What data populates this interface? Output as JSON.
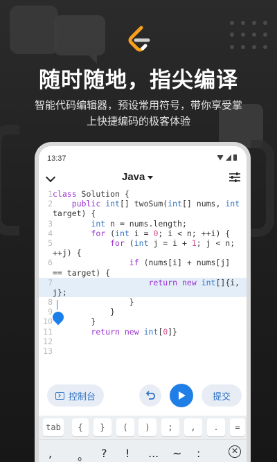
{
  "promo": {
    "headline": "随时随地，指尖编译",
    "subline1": "智能代码编辑器，预设常用符号，带你享受掌",
    "subline2": "上快捷编码的极客体验",
    "accent_color": "#f89f1b",
    "logo_icon": "leetcode-logo-icon"
  },
  "status_bar": {
    "time": "13:37",
    "icons": [
      "wifi-icon",
      "signal-icon",
      "battery-icon"
    ]
  },
  "toolbar": {
    "collapse_icon": "chevron-down-icon",
    "language": "Java",
    "settings_icon": "tune-icon"
  },
  "editor": {
    "lines": [
      {
        "n": "1",
        "text": "class Solution {"
      },
      {
        "n": "2",
        "text": "    public int[] twoSum(int[] nums, int"
      },
      {
        "n": "",
        "text": "target) {"
      },
      {
        "n": "3",
        "text": "        int n = nums.length;"
      },
      {
        "n": "4",
        "text": "        for (int i = 0; i < n; ++i) {"
      },
      {
        "n": "5",
        "text": "            for (int j = i + 1; j < n;"
      },
      {
        "n": "",
        "text": "++j) {"
      },
      {
        "n": "6",
        "text": "                if (nums[i] + nums[j]"
      },
      {
        "n": "",
        "text": "== target) {"
      },
      {
        "n": "7",
        "text": "                    return new int[]{i,"
      },
      {
        "n": "",
        "text": "j};"
      },
      {
        "n": "8",
        "text": "                }"
      },
      {
        "n": "9",
        "text": "            }"
      },
      {
        "n": "10",
        "text": "        }"
      },
      {
        "n": "11",
        "text": "        return new int[0]}"
      },
      {
        "n": "12",
        "text": ""
      },
      {
        "n": "13",
        "text": ""
      }
    ],
    "highlight_color": "#e3eef9"
  },
  "actions": {
    "console_label": "控制台",
    "submit_label": "提交",
    "undo_icon": "undo-icon",
    "run_icon": "play-icon"
  },
  "symbol_keys": [
    "tab",
    "{",
    "}",
    "(",
    ")",
    ";",
    ",",
    ".",
    "="
  ],
  "ime_keys": [
    ",",
    "。",
    "?",
    "!",
    "...",
    "~",
    ":"
  ],
  "ime_close_icon": "close-circle-icon"
}
